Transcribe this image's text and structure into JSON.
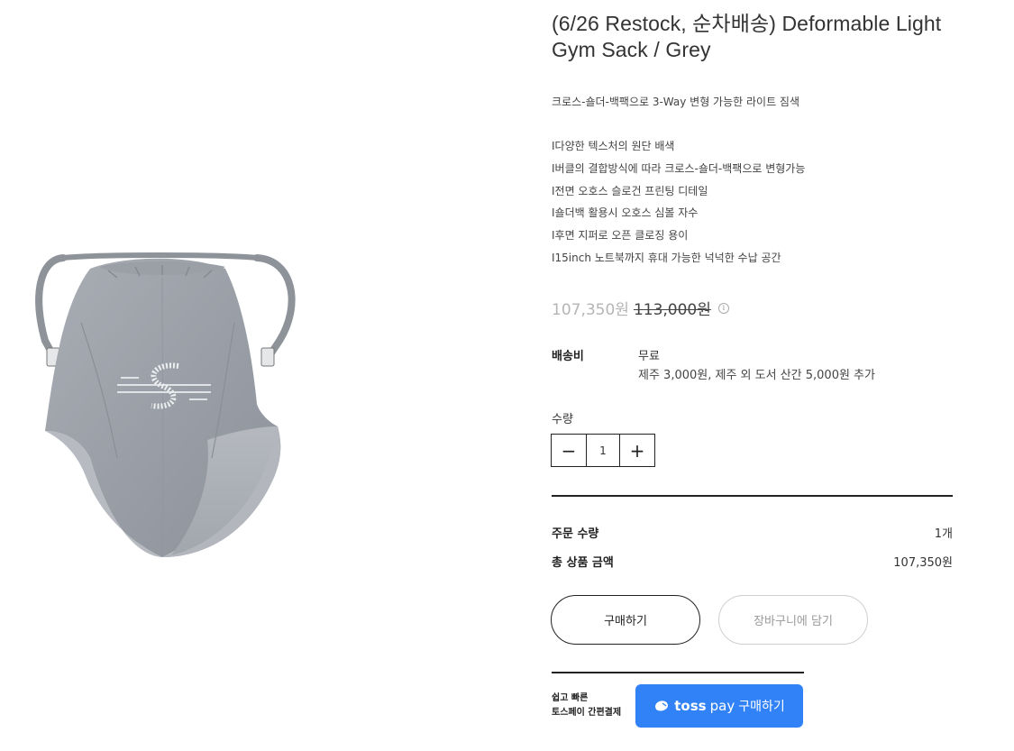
{
  "product": {
    "title": "(6/26 Restock, 순차배송) Deformable Light Gym Sack / Grey",
    "summary": "크로스-숄더-백팩으로 3-Way 변형 가능한 라이트 짐색",
    "features": [
      "I다양한 텍스처의 원단 배색",
      "I버클의 결합방식에 따라 크로스-숄더-백팩으로 변형가능",
      "I전면 오호스 슬로건 프린팅 디테일",
      "I숄더백 활용시 오호스 심볼 자수",
      "I후면 지퍼로 오픈 클로징 용이",
      "I15inch 노트북까지 휴대 가능한 넉넉한 수납 공간"
    ],
    "sale_price": "107,350원",
    "original_price": "113,000원",
    "info_icon": "i"
  },
  "shipping": {
    "label": "배송비",
    "value": "무료",
    "note": "제주 3,000원, 제주 외 도서 산간 5,000원 추가"
  },
  "quantity": {
    "label": "수량",
    "value": "1",
    "minus": "−",
    "plus": "+"
  },
  "summary": {
    "qty_label": "주문 수량",
    "qty_value": "1개",
    "total_label": "총 상품 금액",
    "total_value": "107,350원"
  },
  "actions": {
    "buy": "구매하기",
    "cart": "장바구니에 담기"
  },
  "toss": {
    "caption_line1": "쉽고 빠른",
    "caption_line2": "토스페이 간편결제",
    "logo_text": "toss",
    "pay_text": "pay",
    "button_label": "구매하기",
    "color": "#3182f6"
  }
}
